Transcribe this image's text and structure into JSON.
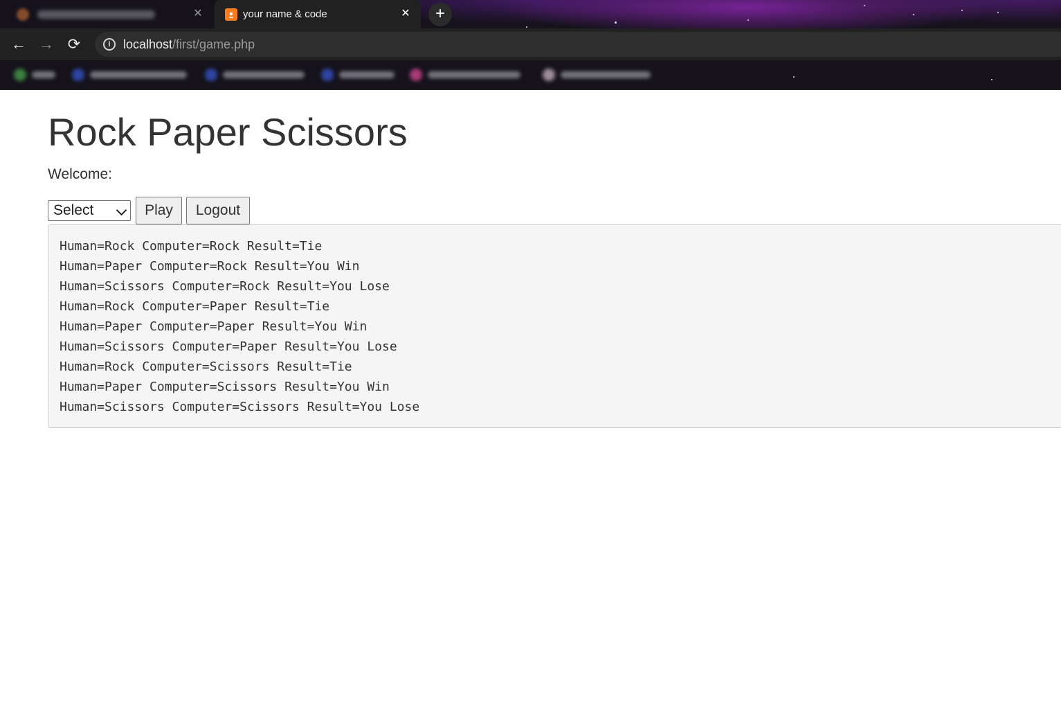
{
  "browser": {
    "tabs": [
      {
        "title": "",
        "state": "inactive"
      },
      {
        "title": "your name & code",
        "state": "active"
      }
    ],
    "close_glyph": "✕",
    "new_tab_glyph": "+",
    "back_glyph": "←",
    "forward_glyph": "→",
    "reload_glyph": "⟳",
    "info_glyph": "i",
    "address": {
      "host": "localhost",
      "path": "/first/game.php"
    },
    "favicon_glyph": "ꔸ",
    "colors": {
      "active_tab": "#212121",
      "toolbar": "#212121",
      "omnibox": "#2e2e2e",
      "favicon": "#f57c1f"
    }
  },
  "page": {
    "title": "Rock Paper Scissors",
    "welcome": "Welcome:",
    "select": {
      "value": "Select"
    },
    "play_label": "Play",
    "logout_label": "Logout",
    "results": [
      "Human=Rock Computer=Rock Result=Tie",
      "Human=Paper Computer=Rock Result=You Win",
      "Human=Scissors Computer=Rock Result=You Lose",
      "Human=Rock Computer=Paper Result=Tie",
      "Human=Paper Computer=Paper Result=You Win",
      "Human=Scissors Computer=Paper Result=You Lose",
      "Human=Rock Computer=Scissors Result=Tie",
      "Human=Paper Computer=Scissors Result=You Win",
      "Human=Scissors Computer=Scissors Result=You Lose"
    ]
  }
}
